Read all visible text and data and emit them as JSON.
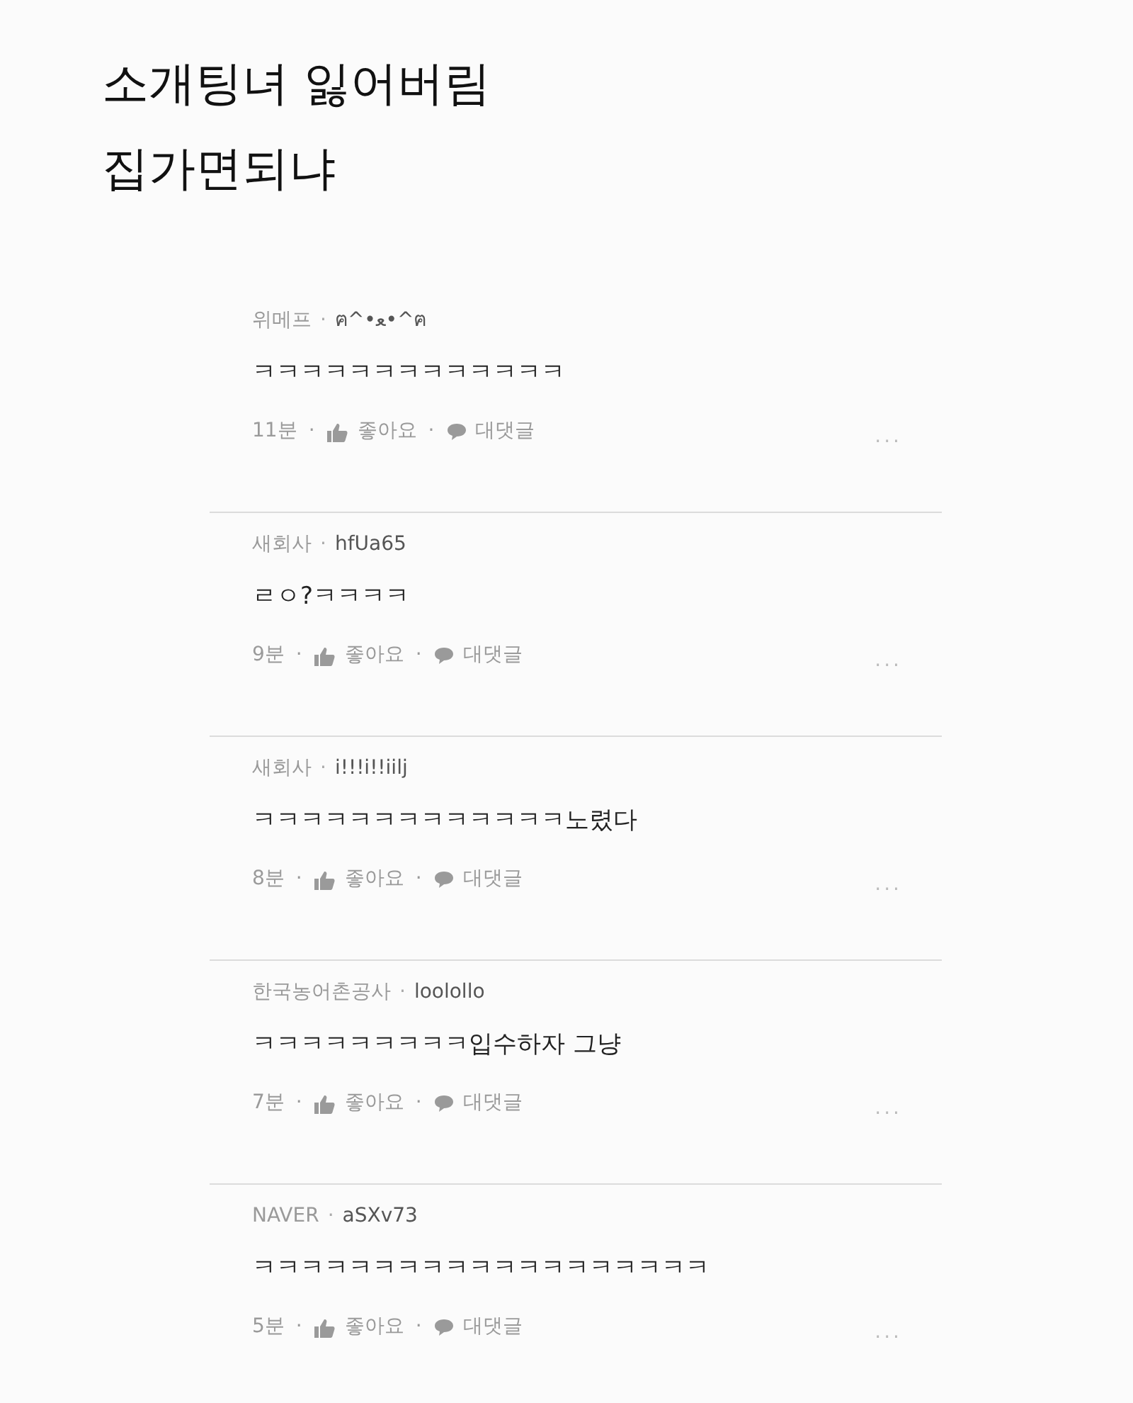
{
  "title_lines": [
    "소개팅녀 잃어버림",
    "집가면되냐"
  ],
  "comments": [
    {
      "separator": "·",
      "company": "위메프",
      "nickname": "ฅ^•ﻌ•^ฅ",
      "text": "ㅋㅋㅋㅋㅋㅋㅋㅋㅋㅋㅋㅋㅋ",
      "time": "11분",
      "like": "좋아요",
      "reply": "대댓글",
      "more": "..."
    },
    {
      "separator": "·",
      "company": "새회사",
      "nickname": "hfUa65",
      "text": "ㄹㅇ?ㅋㅋㅋㅋ",
      "time": "9분",
      "like": "좋아요",
      "reply": "대댓글",
      "more": "..."
    },
    {
      "separator": "·",
      "company": "새회사",
      "nickname": "i!!!i!!iilj",
      "text": "ㅋㅋㅋㅋㅋㅋㅋㅋㅋㅋㅋㅋㅋ노렸다",
      "time": "8분",
      "like": "좋아요",
      "reply": "대댓글",
      "more": "..."
    },
    {
      "separator": "·",
      "company": "한국농어촌공사",
      "nickname": "loolollo",
      "text": "ㅋㅋㅋㅋㅋㅋㅋㅋㅋ입수하자 그냥",
      "time": "7분",
      "like": "좋아요",
      "reply": "대댓글",
      "more": "..."
    },
    {
      "separator": "·",
      "company": "NAVER",
      "nickname": "aSXv73",
      "text": "ㅋㅋㅋㅋㅋㅋㅋㅋㅋㅋㅋㅋㅋㅋㅋㅋㅋㅋㅋ",
      "time": "5분",
      "like": "좋아요",
      "reply": "대댓글",
      "more": "..."
    }
  ]
}
